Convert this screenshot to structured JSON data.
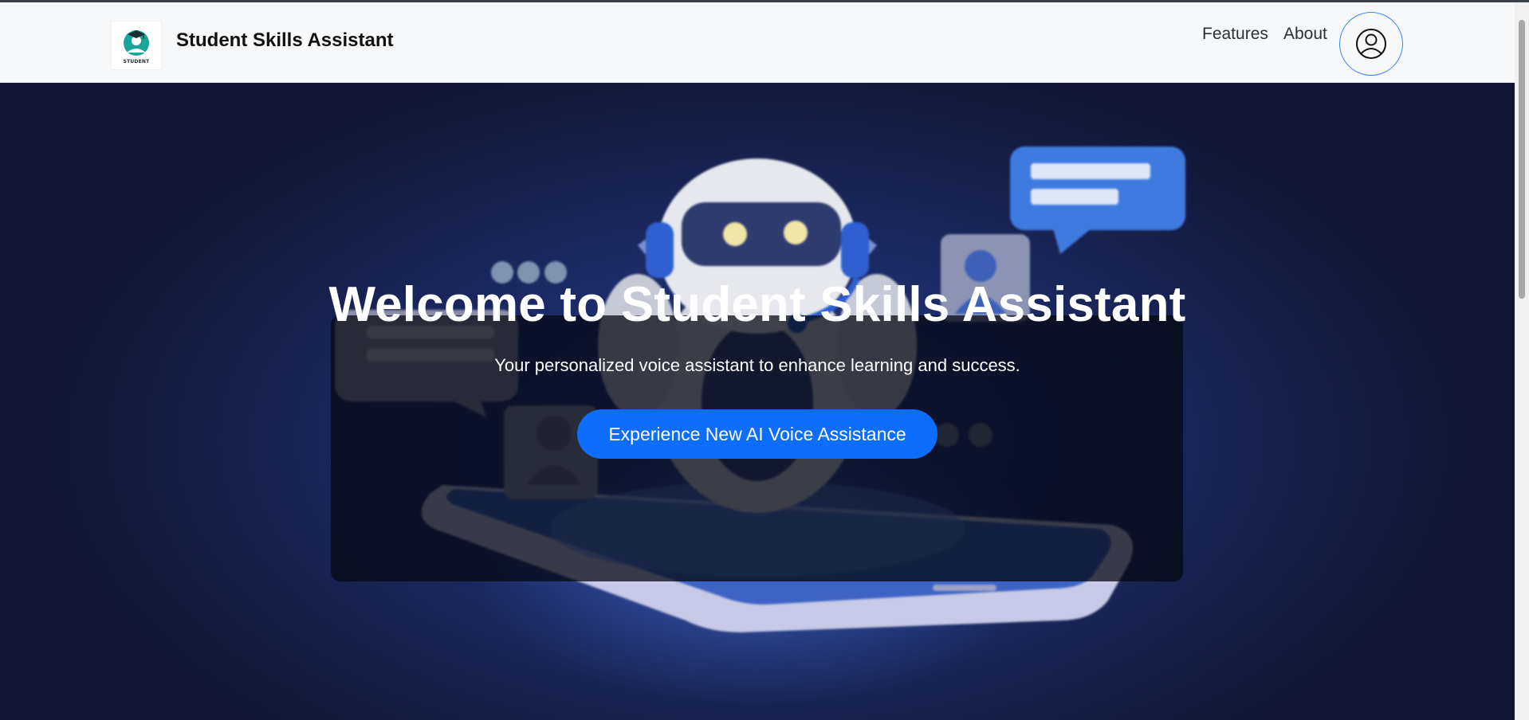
{
  "navbar": {
    "logo_text": "STUDENT",
    "brand_name": "Student Skills Assistant",
    "links": [
      "Features",
      "About"
    ],
    "profile_icon": "user-circle-icon"
  },
  "hero": {
    "title": "Welcome to Student Skills Assistant",
    "subtitle": "Your personalized voice assistant to enhance learning and success.",
    "cta_label": "Experience New AI Voice Assistance",
    "illustration": "robot-with-headset-on-phone-illustration"
  },
  "colors": {
    "accent": "#0d6efd",
    "navbar_bg": "#f7f8fa",
    "hero_bg": "#1c2a66",
    "logo_teal": "#1aa59a"
  }
}
